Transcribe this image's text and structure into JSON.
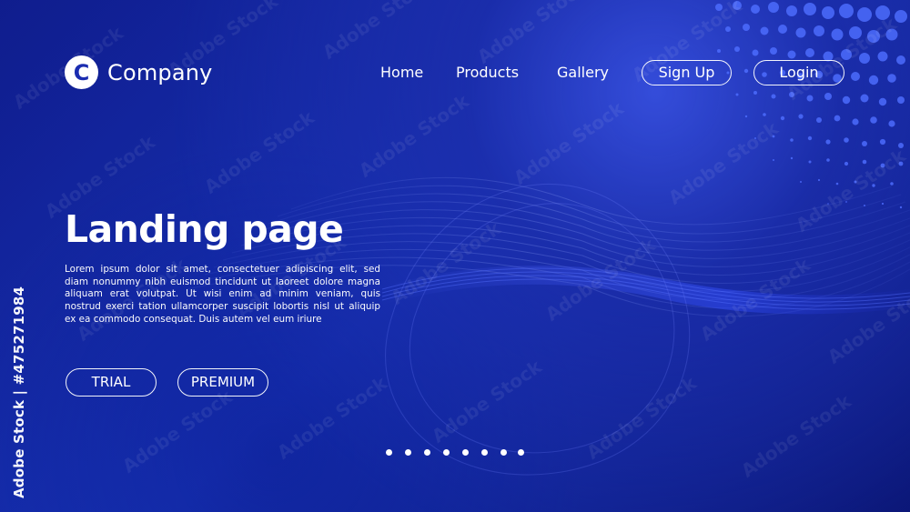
{
  "brand": {
    "logo_letter": "C",
    "name": "Company"
  },
  "nav": {
    "home": "Home",
    "products": "Products",
    "gallery": "Gallery",
    "sign_up": "Sign Up",
    "login": "Login"
  },
  "hero": {
    "title": "Landing page",
    "body": "Lorem ipsum dolor sit amet, consectetuer adipiscing elit, sed diam nonummy nibh euismod tincidunt ut laoreet dolore magna aliquam erat volutpat. Ut wisi enim ad minim veniam, quis nostrud exerci tation ullamcorper suscipit lobortis nisl ut aliquip ex ea commodo consequat. Duis autem vel eum iriure"
  },
  "actions": {
    "trial": "TRIAL",
    "premium": "PREMIUM"
  },
  "pagination": {
    "count": 8
  },
  "stock": {
    "id_text": "Adobe Stock | #475271984",
    "watermark": "Adobe Stock"
  },
  "colors": {
    "primary": "#1733b9",
    "secondary": "#0f1d8f",
    "accent": "#4d66ff",
    "text": "#ffffff"
  },
  "icons": {
    "logo": "company-logo-icon",
    "pagination": "pagination-dot-icon"
  }
}
